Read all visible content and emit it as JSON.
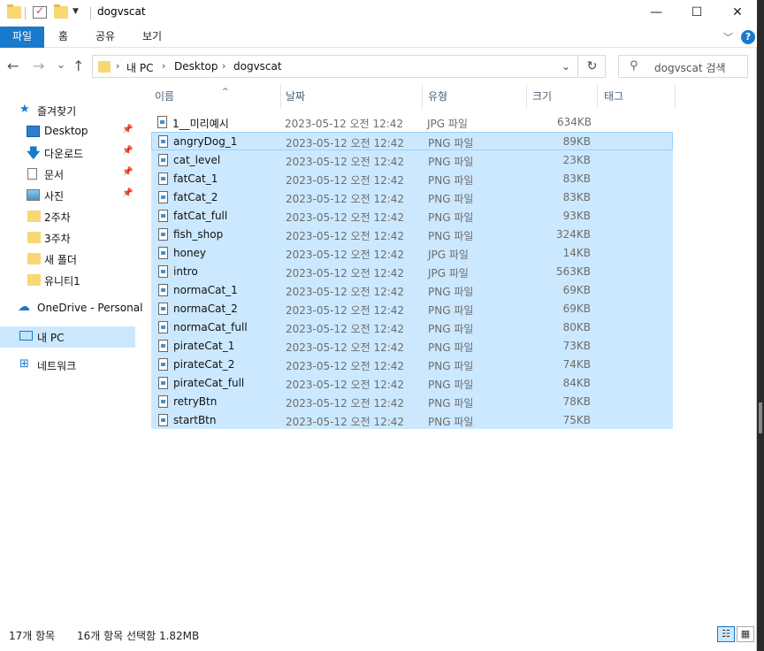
{
  "window": {
    "title": "dogvscat"
  },
  "window_controls": {
    "minimize": "—",
    "maximize": "☐",
    "close": "✕"
  },
  "ribbon": {
    "tabs": [
      "파일",
      "홈",
      "공유",
      "보기"
    ],
    "collapse_icon": "chevron-down-icon",
    "help_label": "?"
  },
  "nav": {
    "back": "←",
    "forward": "→",
    "recent": "⌄",
    "up": "↑",
    "breadcrumb": [
      "내 PC",
      "Desktop",
      "dogvscat"
    ],
    "refresh": "↻",
    "search_placeholder": "dogvscat 검색"
  },
  "sidebar": {
    "items": [
      {
        "label": "즐겨찾기",
        "icon": "star-icon"
      },
      {
        "label": "Desktop",
        "icon": "desktop-icon",
        "pinned": true
      },
      {
        "label": "다운로드",
        "icon": "download-icon",
        "pinned": true
      },
      {
        "label": "문서",
        "icon": "document-icon",
        "pinned": true
      },
      {
        "label": "사진",
        "icon": "picture-icon",
        "pinned": true
      },
      {
        "label": "2주차",
        "icon": "folder-icon"
      },
      {
        "label": "3주차",
        "icon": "folder-icon"
      },
      {
        "label": "새 폴더",
        "icon": "folder-icon"
      },
      {
        "label": "유니티1",
        "icon": "folder-icon"
      },
      {
        "label": "OneDrive - Personal",
        "icon": "cloud-icon"
      },
      {
        "label": "내 PC",
        "icon": "pc-icon",
        "selected": true
      },
      {
        "label": "네트워크",
        "icon": "network-icon"
      }
    ]
  },
  "columns": [
    "이름",
    "날짜",
    "유형",
    "크기",
    "태그"
  ],
  "files": [
    {
      "name": "1__미리예시",
      "date": "2023-05-12 오전 12:42",
      "type": "JPG 파일",
      "size": "634KB",
      "selected": false
    },
    {
      "name": "angryDog_1",
      "date": "2023-05-12 오전 12:42",
      "type": "PNG 파일",
      "size": "89KB",
      "selected": true
    },
    {
      "name": "cat_level",
      "date": "2023-05-12 오전 12:42",
      "type": "PNG 파일",
      "size": "23KB",
      "selected": true
    },
    {
      "name": "fatCat_1",
      "date": "2023-05-12 오전 12:42",
      "type": "PNG 파일",
      "size": "83KB",
      "selected": true
    },
    {
      "name": "fatCat_2",
      "date": "2023-05-12 오전 12:42",
      "type": "PNG 파일",
      "size": "83KB",
      "selected": true
    },
    {
      "name": "fatCat_full",
      "date": "2023-05-12 오전 12:42",
      "type": "PNG 파일",
      "size": "93KB",
      "selected": true
    },
    {
      "name": "fish_shop",
      "date": "2023-05-12 오전 12:42",
      "type": "PNG 파일",
      "size": "324KB",
      "selected": true
    },
    {
      "name": "honey",
      "date": "2023-05-12 오전 12:42",
      "type": "JPG 파일",
      "size": "14KB",
      "selected": true
    },
    {
      "name": "intro",
      "date": "2023-05-12 오전 12:42",
      "type": "JPG 파일",
      "size": "563KB",
      "selected": true
    },
    {
      "name": "normaCat_1",
      "date": "2023-05-12 오전 12:42",
      "type": "PNG 파일",
      "size": "69KB",
      "selected": true
    },
    {
      "name": "normaCat_2",
      "date": "2023-05-12 오전 12:42",
      "type": "PNG 파일",
      "size": "69KB",
      "selected": true
    },
    {
      "name": "normaCat_full",
      "date": "2023-05-12 오전 12:42",
      "type": "PNG 파일",
      "size": "80KB",
      "selected": true
    },
    {
      "name": "pirateCat_1",
      "date": "2023-05-12 오전 12:42",
      "type": "PNG 파일",
      "size": "73KB",
      "selected": true
    },
    {
      "name": "pirateCat_2",
      "date": "2023-05-12 오전 12:42",
      "type": "PNG 파일",
      "size": "74KB",
      "selected": true
    },
    {
      "name": "pirateCat_full",
      "date": "2023-05-12 오전 12:42",
      "type": "PNG 파일",
      "size": "84KB",
      "selected": true
    },
    {
      "name": "retryBtn",
      "date": "2023-05-12 오전 12:42",
      "type": "PNG 파일",
      "size": "78KB",
      "selected": true
    },
    {
      "name": "startBtn",
      "date": "2023-05-12 오전 12:42",
      "type": "PNG 파일",
      "size": "75KB",
      "selected": true
    }
  ],
  "status": {
    "item_count": "17개 항목",
    "selection": "16개 항목 선택함 1.82MB"
  },
  "colors": {
    "accent": "#1979ca",
    "selection": "#cce8ff",
    "selection_border": "#99d1ff"
  }
}
